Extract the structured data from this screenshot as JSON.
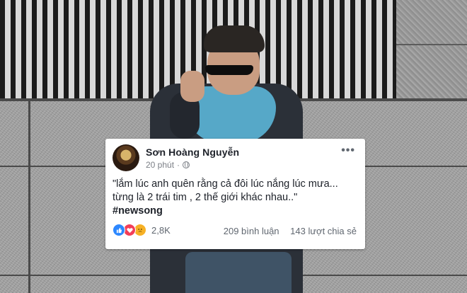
{
  "post": {
    "author_name": "Sơn Hoàng Nguyễn",
    "time": "20 phút",
    "time_separator": "·",
    "more_label": "•••",
    "text_line1": "\"lắm lúc anh quên rằng cả đôi lúc nắng lúc mưa...",
    "text_line2": "từng là 2 trái tim , 2 thế giới khác nhau..\"",
    "hashtag": "#newsong",
    "reaction_icons": [
      "like-icon",
      "love-icon",
      "sad-icon"
    ],
    "reaction_count": "2,8K",
    "comments": "209 bình luận",
    "shares": "143 lượt chia sẻ"
  },
  "colors": {
    "card_bg": "#ffffff",
    "text": "#1d2129",
    "meta": "#7b7f86",
    "like": "#2d88ff",
    "love": "#f33e58",
    "sad": "#f7b125"
  }
}
